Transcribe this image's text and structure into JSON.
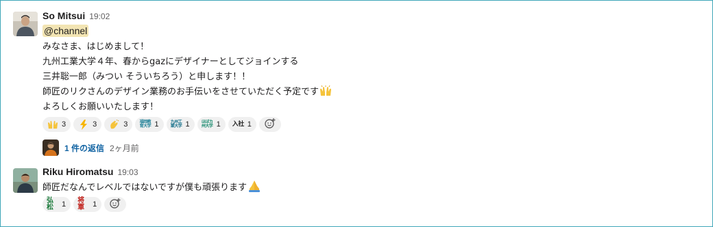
{
  "messages": [
    {
      "author": "So Mitsui",
      "time": "19:02",
      "mention": "@channel",
      "lines": [
        "みなさま、はじめまして！",
        "九州工業大学４年、春からgazにデザイナーとしてジョインする",
        "三井聡一郎（みつい そういちろう）と申します！！",
        "師匠のリクさんのデザイン業務のお手伝いをさせていただく予定です",
        "よろしくお願いいたします！"
      ],
      "reactions": [
        {
          "icon": "raised-hands-icon",
          "count": "3"
        },
        {
          "icon": "zap-icon",
          "count": "3"
        },
        {
          "icon": "clapping-hands-icon",
          "count": "3"
        },
        {
          "icon": "fukuoka-university-custom-emoji",
          "label": "福岡教育大学",
          "count": "1"
        },
        {
          "icon": "kyushu-tech-custom-emoji",
          "label": "九州工業大学",
          "count": "1"
        },
        {
          "icon": "hofu-custom-emoji",
          "label": "ほぼカ州大学",
          "count": "1"
        },
        {
          "icon": "nyuusha-custom-emoji",
          "label": "入社",
          "count": "1"
        }
      ],
      "thread": {
        "count": "1 件の返信",
        "time": "2ヶ月前"
      }
    },
    {
      "author": "Riku Hiromatsu",
      "time": "19:03",
      "lines": [
        "師匠だなんでレベルではないですが僕も頑張ります"
      ],
      "reactions": [
        {
          "icon": "kosho-custom-emoji",
          "label": "弘松",
          "count": "1"
        },
        {
          "icon": "shogun-custom-emoji",
          "label": "将軍",
          "count": "1"
        }
      ]
    }
  ],
  "colors": {
    "link": "#1264a3",
    "mention_bg": "#f2e4b3",
    "reaction_bg": "#f0f0f0",
    "border": "#3ea6b8"
  }
}
